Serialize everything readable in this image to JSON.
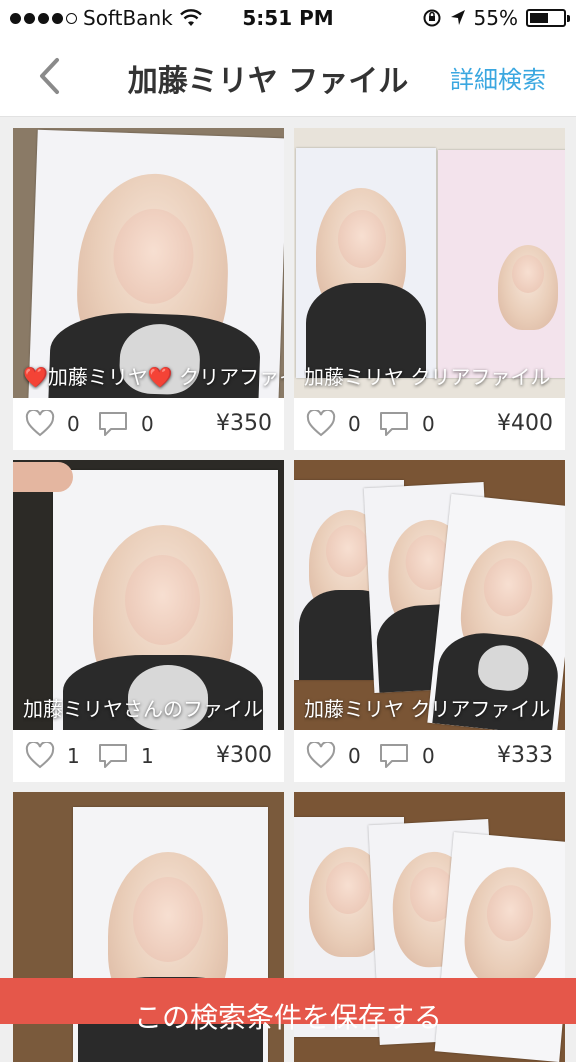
{
  "status": {
    "carrier": "SoftBank",
    "time": "5:51 PM",
    "battery": "55%",
    "battery_level": 0.55
  },
  "nav": {
    "title": "加藤ミリヤ ファイル",
    "advanced_search": "詳細検索"
  },
  "items": [
    {
      "caption": "❤️加藤ミリヤ❤️ クリアファイル",
      "likes": "0",
      "comments": "0",
      "price": "¥350"
    },
    {
      "caption": "加藤ミリヤ クリアファイル",
      "likes": "0",
      "comments": "0",
      "price": "¥400"
    },
    {
      "caption": "加藤ミリヤさんのファイル",
      "likes": "1",
      "comments": "1",
      "price": "¥300"
    },
    {
      "caption": "加藤ミリヤ クリアファイル",
      "likes": "0",
      "comments": "0",
      "price": "¥333"
    },
    {
      "caption": "",
      "likes": "",
      "comments": "",
      "price": ""
    },
    {
      "caption": "",
      "likes": "",
      "comments": "",
      "price": ""
    }
  ],
  "save_button": "この検索条件を保存する",
  "colors": {
    "accent": "#3aa7e0",
    "save": "#e5574a"
  }
}
